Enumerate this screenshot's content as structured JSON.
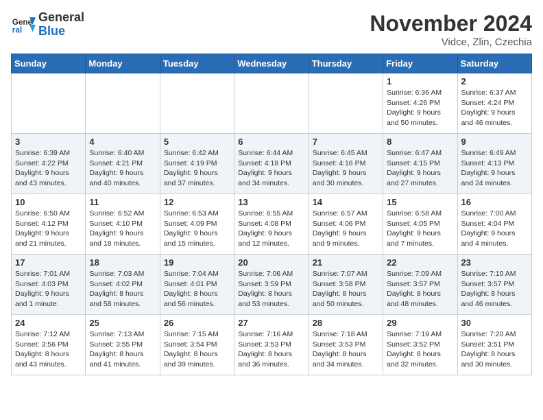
{
  "header": {
    "logo_general": "General",
    "logo_blue": "Blue",
    "title": "November 2024",
    "location": "Vidce, Zlin, Czechia"
  },
  "columns": [
    "Sunday",
    "Monday",
    "Tuesday",
    "Wednesday",
    "Thursday",
    "Friday",
    "Saturday"
  ],
  "weeks": [
    [
      {
        "day": "",
        "detail": ""
      },
      {
        "day": "",
        "detail": ""
      },
      {
        "day": "",
        "detail": ""
      },
      {
        "day": "",
        "detail": ""
      },
      {
        "day": "",
        "detail": ""
      },
      {
        "day": "1",
        "detail": "Sunrise: 6:36 AM\nSunset: 4:26 PM\nDaylight: 9 hours\nand 50 minutes."
      },
      {
        "day": "2",
        "detail": "Sunrise: 6:37 AM\nSunset: 4:24 PM\nDaylight: 9 hours\nand 46 minutes."
      }
    ],
    [
      {
        "day": "3",
        "detail": "Sunrise: 6:39 AM\nSunset: 4:22 PM\nDaylight: 9 hours\nand 43 minutes."
      },
      {
        "day": "4",
        "detail": "Sunrise: 6:40 AM\nSunset: 4:21 PM\nDaylight: 9 hours\nand 40 minutes."
      },
      {
        "day": "5",
        "detail": "Sunrise: 6:42 AM\nSunset: 4:19 PM\nDaylight: 9 hours\nand 37 minutes."
      },
      {
        "day": "6",
        "detail": "Sunrise: 6:44 AM\nSunset: 4:18 PM\nDaylight: 9 hours\nand 34 minutes."
      },
      {
        "day": "7",
        "detail": "Sunrise: 6:45 AM\nSunset: 4:16 PM\nDaylight: 9 hours\nand 30 minutes."
      },
      {
        "day": "8",
        "detail": "Sunrise: 6:47 AM\nSunset: 4:15 PM\nDaylight: 9 hours\nand 27 minutes."
      },
      {
        "day": "9",
        "detail": "Sunrise: 6:49 AM\nSunset: 4:13 PM\nDaylight: 9 hours\nand 24 minutes."
      }
    ],
    [
      {
        "day": "10",
        "detail": "Sunrise: 6:50 AM\nSunset: 4:12 PM\nDaylight: 9 hours\nand 21 minutes."
      },
      {
        "day": "11",
        "detail": "Sunrise: 6:52 AM\nSunset: 4:10 PM\nDaylight: 9 hours\nand 18 minutes."
      },
      {
        "day": "12",
        "detail": "Sunrise: 6:53 AM\nSunset: 4:09 PM\nDaylight: 9 hours\nand 15 minutes."
      },
      {
        "day": "13",
        "detail": "Sunrise: 6:55 AM\nSunset: 4:08 PM\nDaylight: 9 hours\nand 12 minutes."
      },
      {
        "day": "14",
        "detail": "Sunrise: 6:57 AM\nSunset: 4:06 PM\nDaylight: 9 hours\nand 9 minutes."
      },
      {
        "day": "15",
        "detail": "Sunrise: 6:58 AM\nSunset: 4:05 PM\nDaylight: 9 hours\nand 7 minutes."
      },
      {
        "day": "16",
        "detail": "Sunrise: 7:00 AM\nSunset: 4:04 PM\nDaylight: 9 hours\nand 4 minutes."
      }
    ],
    [
      {
        "day": "17",
        "detail": "Sunrise: 7:01 AM\nSunset: 4:03 PM\nDaylight: 9 hours\nand 1 minute."
      },
      {
        "day": "18",
        "detail": "Sunrise: 7:03 AM\nSunset: 4:02 PM\nDaylight: 8 hours\nand 58 minutes."
      },
      {
        "day": "19",
        "detail": "Sunrise: 7:04 AM\nSunset: 4:01 PM\nDaylight: 8 hours\nand 56 minutes."
      },
      {
        "day": "20",
        "detail": "Sunrise: 7:06 AM\nSunset: 3:59 PM\nDaylight: 8 hours\nand 53 minutes."
      },
      {
        "day": "21",
        "detail": "Sunrise: 7:07 AM\nSunset: 3:58 PM\nDaylight: 8 hours\nand 50 minutes."
      },
      {
        "day": "22",
        "detail": "Sunrise: 7:09 AM\nSunset: 3:57 PM\nDaylight: 8 hours\nand 48 minutes."
      },
      {
        "day": "23",
        "detail": "Sunrise: 7:10 AM\nSunset: 3:57 PM\nDaylight: 8 hours\nand 46 minutes."
      }
    ],
    [
      {
        "day": "24",
        "detail": "Sunrise: 7:12 AM\nSunset: 3:56 PM\nDaylight: 8 hours\nand 43 minutes."
      },
      {
        "day": "25",
        "detail": "Sunrise: 7:13 AM\nSunset: 3:55 PM\nDaylight: 8 hours\nand 41 minutes."
      },
      {
        "day": "26",
        "detail": "Sunrise: 7:15 AM\nSunset: 3:54 PM\nDaylight: 8 hours\nand 39 minutes."
      },
      {
        "day": "27",
        "detail": "Sunrise: 7:16 AM\nSunset: 3:53 PM\nDaylight: 8 hours\nand 36 minutes."
      },
      {
        "day": "28",
        "detail": "Sunrise: 7:18 AM\nSunset: 3:53 PM\nDaylight: 8 hours\nand 34 minutes."
      },
      {
        "day": "29",
        "detail": "Sunrise: 7:19 AM\nSunset: 3:52 PM\nDaylight: 8 hours\nand 32 minutes."
      },
      {
        "day": "30",
        "detail": "Sunrise: 7:20 AM\nSunset: 3:51 PM\nDaylight: 8 hours\nand 30 minutes."
      }
    ]
  ]
}
